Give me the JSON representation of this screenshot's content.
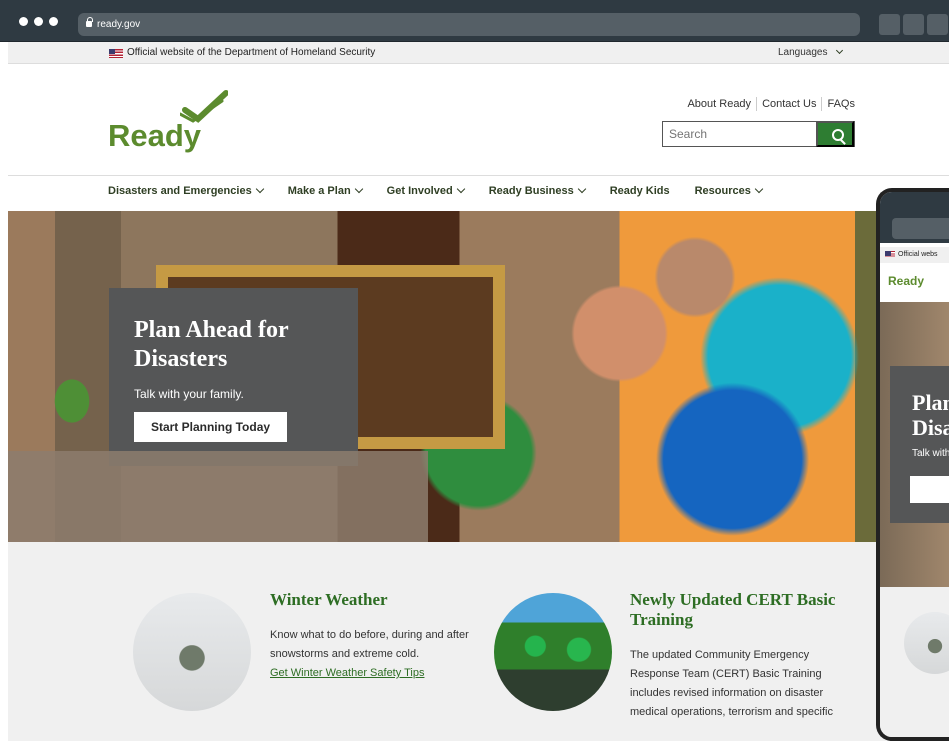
{
  "browser": {
    "url": "ready.gov"
  },
  "gov_banner": {
    "official_text": "Official website of the Department of Homeland Security",
    "languages_label": "Languages"
  },
  "brand": {
    "logo_text": "Ready",
    "primary_color": "#5c8b2e",
    "link_color": "#2d6d23"
  },
  "header": {
    "links": [
      "About Ready",
      "Contact Us",
      "FAQs"
    ],
    "search_placeholder": "Search"
  },
  "navigation": {
    "items": [
      {
        "label": "Disasters and Emergencies",
        "has_dropdown": true
      },
      {
        "label": "Make a Plan",
        "has_dropdown": true
      },
      {
        "label": "Get Involved",
        "has_dropdown": true
      },
      {
        "label": "Ready Business",
        "has_dropdown": true
      },
      {
        "label": "Ready Kids",
        "has_dropdown": false
      },
      {
        "label": "Resources",
        "has_dropdown": true
      }
    ]
  },
  "hero": {
    "title": "Plan Ahead for Disasters",
    "subtitle": "Talk with your family.",
    "button_label": "Start Planning Today"
  },
  "features": [
    {
      "title": "Winter Weather",
      "description": "Know what to do before, during and after snowstorms and extreme cold.",
      "link": "Get Winter Weather Safety Tips"
    },
    {
      "title": "Newly Updated CERT Basic Training",
      "description": "The updated Community Emergency Response Team (CERT) Basic Training includes revised information on disaster medical operations, terrorism and specific"
    }
  ],
  "mobile_preview": {
    "official_text": "Official webs",
    "logo_text": "Ready",
    "hero_title_line1": "Plan",
    "hero_title_line2": "Disa",
    "hero_subtitle": "Talk with"
  }
}
